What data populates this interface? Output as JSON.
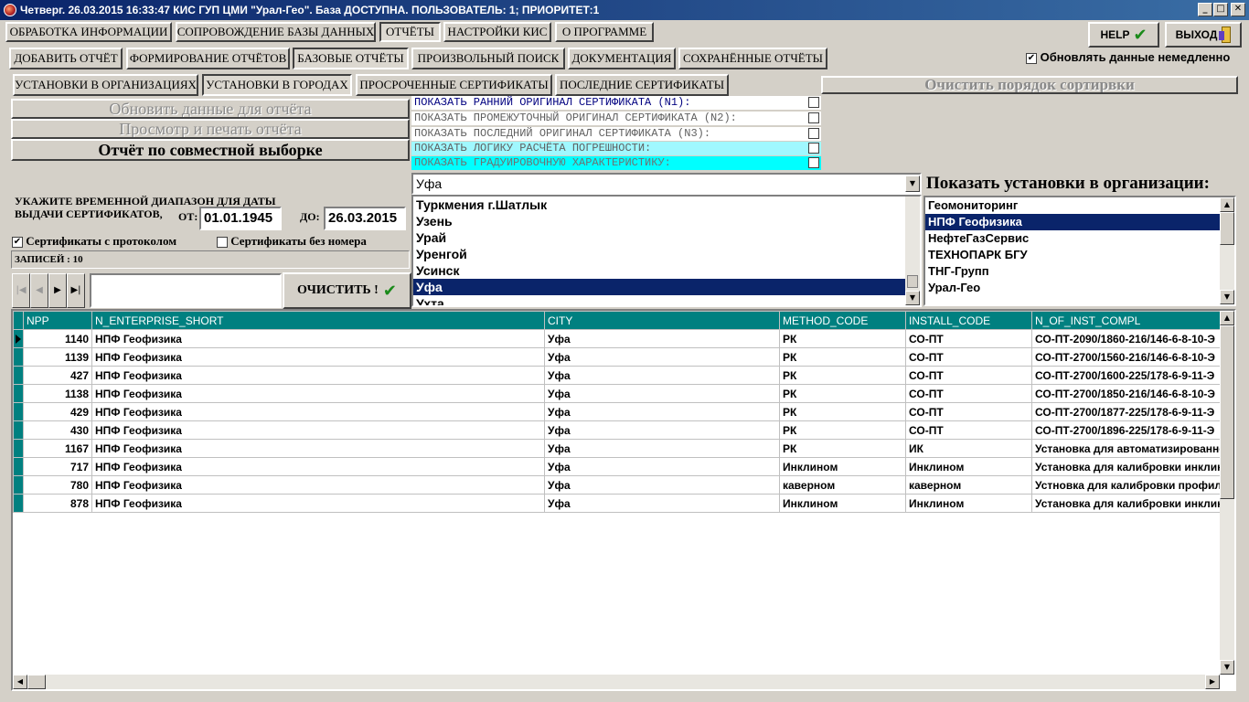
{
  "window": {
    "title": "Четверг. 26.03.2015 16:33:47 КИС ГУП ЦМИ \"Урал-Гео\". База ДОСТУПНА. ПОЛЬЗОВАТЕЛЬ: 1; ПРИОРИТЕТ:1",
    "minimize": "_",
    "maximize": "□",
    "close": "✕"
  },
  "main_menu": [
    {
      "label": "ОБРАБОТКА ИНФОРМАЦИИ"
    },
    {
      "label": "СОПРОВОЖДЕНИЕ БАЗЫ ДАННЫХ"
    },
    {
      "label": "ОТЧЁТЫ"
    },
    {
      "label": "НАСТРОЙКИ КИС"
    },
    {
      "label": "О ПРОГРАММЕ"
    }
  ],
  "help_label": "HELP",
  "exit_label": "ВЫХОД",
  "report_tabs": [
    {
      "label": "ДОБАВИТЬ ОТЧЁТ"
    },
    {
      "label": "ФОРМИРОВАНИЕ ОТЧЁТОВ"
    },
    {
      "label": "БАЗОВЫЕ ОТЧЁТЫ"
    },
    {
      "label": "ПРОИЗВОЛЬНЫЙ ПОИСК"
    },
    {
      "label": "ДОКУМЕНТАЦИЯ"
    },
    {
      "label": "СОХРАНЁННЫЕ ОТЧЁТЫ"
    }
  ],
  "update_immediately": {
    "label": "Обновлять данные немедленно",
    "checked": true
  },
  "sub_tabs": [
    {
      "label": "УСТАНОВКИ В ОРГАНИЗАЦИЯХ"
    },
    {
      "label": "УСТАНОВКИ В ГОРОДАХ"
    },
    {
      "label": "ПРОСРОЧЕННЫЕ СЕРТИФИКАТЫ"
    },
    {
      "label": "ПОСЛЕДНИЕ СЕРТИФИКАТЫ"
    }
  ],
  "clear_sort_label": "Очистить порядок сортирвки",
  "actions": {
    "refresh": "Обновить данные для отчёта",
    "preview": "Просмотр и печать отчёта",
    "joint": "Отчёт по совместной выборке"
  },
  "options": [
    {
      "label": "ПОКАЗАТЬ РАННИЙ ОРИГИНАЛ СЕРТИФИКАТА (N1):",
      "color": "#ffffff",
      "text_color": "#000080"
    },
    {
      "label": "ПОКАЗАТЬ ПРОМЕЖУТОЧНЫЙ ОРИГИНАЛ СЕРТИФИКАТА (N2):",
      "color": "#ffffff",
      "text_color": "#606060"
    },
    {
      "label": "ПОКАЗАТЬ ПОСЛЕДНИЙ ОРИГИНАЛ СЕРТИФИКАТА (N3):",
      "color": "#ffffff",
      "text_color": "#606060"
    },
    {
      "label": "ПОКАЗАТЬ ЛОГИКУ РАСЧЁТА ПОГРЕШНОСТИ:",
      "color": "#a0f8ff",
      "text_color": "#606060"
    },
    {
      "label": "ПОКАЗАТЬ ГРАДУИРОВОЧНУЮ ХАРАКТЕРИСТИКУ:",
      "color": "#00ffff",
      "text_color": "#707070"
    }
  ],
  "date_range": {
    "caption": "УКАЖИТЕ ВРЕМЕННОЙ ДИАПАЗОН ДЛЯ ДАТЫ ВЫДАЧИ СЕРТИФИКАТОВ,",
    "from_label": "ОТ:",
    "from": "01.01.1945",
    "to_label": "ДО:",
    "to": "26.03.2015"
  },
  "with_protocol": {
    "label": "Сертификаты с протоколом",
    "checked": true
  },
  "without_number": {
    "label": "Сертификаты без номера",
    "checked": false
  },
  "records_label": "ЗАПИСЕЙ : 10",
  "clear_label": "ОЧИСТИТЬ !",
  "city_combo": {
    "value": "Уфа"
  },
  "city_list": [
    {
      "label": "Туркмения г.Шатлык",
      "selected": false
    },
    {
      "label": "Узень",
      "selected": false
    },
    {
      "label": "Урай",
      "selected": false
    },
    {
      "label": "Уренгой",
      "selected": false
    },
    {
      "label": "Усинск",
      "selected": false
    },
    {
      "label": "Уфа",
      "selected": true
    },
    {
      "label": "Ухта",
      "selected": false
    }
  ],
  "org_heading": "Показать установки в организации:",
  "org_list": [
    {
      "label": "Геомониторинг",
      "selected": false
    },
    {
      "label": "НПФ Геофизика",
      "selected": true
    },
    {
      "label": "НефтеГазСервис",
      "selected": false
    },
    {
      "label": "ТЕХНОПАРК БГУ",
      "selected": false
    },
    {
      "label": "ТНГ-Групп",
      "selected": false
    },
    {
      "label": "Урал-Гео",
      "selected": false
    }
  ],
  "grid": {
    "columns": [
      "NPP",
      "N_ENTERPRISE_SHORT",
      "CITY",
      "METHOD_CODE",
      "INSTALL_CODE",
      "N_OF_INST_COMPL"
    ],
    "rows": [
      [
        "1140",
        "НПФ Геофизика",
        "Уфа",
        "РК",
        "СО-ПТ",
        "СО-ПТ-2090/1860-216/146-6-8-10-Э"
      ],
      [
        "1139",
        "НПФ Геофизика",
        "Уфа",
        "РК",
        "СО-ПТ",
        "СО-ПТ-2700/1560-216/146-6-8-10-Э"
      ],
      [
        "427",
        "НПФ Геофизика",
        "Уфа",
        "РК",
        "СО-ПТ",
        "СО-ПТ-2700/1600-225/178-6-9-11-Э"
      ],
      [
        "1138",
        "НПФ Геофизика",
        "Уфа",
        "РК",
        "СО-ПТ",
        "СО-ПТ-2700/1850-216/146-6-8-10-Э"
      ],
      [
        "429",
        "НПФ Геофизика",
        "Уфа",
        "РК",
        "СО-ПТ",
        "СО-ПТ-2700/1877-225/178-6-9-11-Э"
      ],
      [
        "430",
        "НПФ Геофизика",
        "Уфа",
        "РК",
        "СО-ПТ",
        "СО-ПТ-2700/1896-225/178-6-9-11-Э"
      ],
      [
        "1167",
        "НПФ Геофизика",
        "Уфа",
        "РК",
        "ИК",
        "Установка для автоматизированно"
      ],
      [
        "717",
        "НПФ Геофизика",
        "Уфа",
        "Инклином",
        "Инклином",
        "Установка для калибровки инклин"
      ],
      [
        "780",
        "НПФ Геофизика",
        "Уфа",
        "каверном",
        "каверном",
        "Устновка для калибровки профило"
      ],
      [
        "878",
        "НПФ Геофизика",
        "Уфа",
        "Инклином",
        "Инклином",
        "Установка для калибровки инклин"
      ]
    ]
  }
}
